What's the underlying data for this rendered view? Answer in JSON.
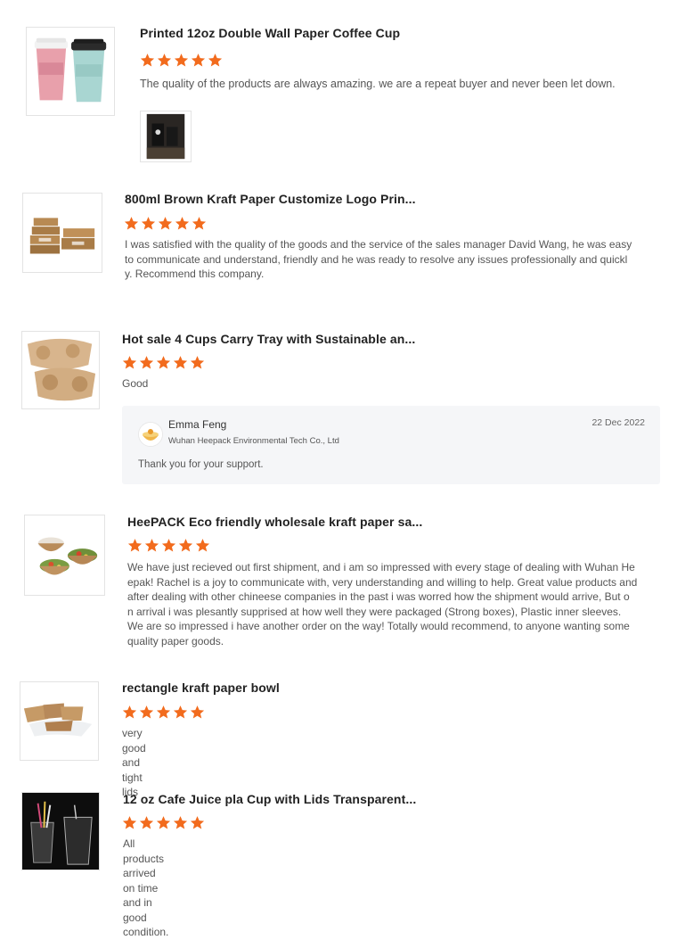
{
  "star_color": "#f26b1d",
  "reviews": [
    {
      "product_title": "Printed 12oz Double Wall Paper Coffee Cup",
      "rating": 5,
      "text": "The quality of the products are always amazing. we are a repeat buyer and never been let down.",
      "has_photo_attachment": true
    },
    {
      "product_title": "800ml Brown Kraft Paper Customize Logo Prin...",
      "rating": 5,
      "text_lines": [
        "I was satisfied with the quality of the goods and the service of the sales manager David Wang, he was easy",
        "to communicate and understand, friendly and he was ready to resolve any issues professionally and quickl",
        "y. Recommend this company."
      ]
    },
    {
      "product_title": "Hot sale 4 Cups Carry Tray with Sustainable an...",
      "rating": 5,
      "text": "Good",
      "reply": {
        "name": "Emma Feng",
        "company": "Wuhan Heepack Environmental Tech Co., Ltd",
        "date": "22 Dec 2022",
        "text": "Thank you for your support."
      }
    },
    {
      "product_title": "HeePACK Eco friendly wholesale kraft paper sa...",
      "rating": 5,
      "text_lines": [
        "We have just recieved out first shipment, and i am so impressed with every stage of dealing with Wuhan He",
        "epak! Rachel is a joy to communicate with, very understanding and willing to help. Great value products and",
        "after dealing with other chineese companies in the past i was worred how the shipment would arrive, But o",
        "n arrival i was plesantly supprised at how well they were packaged (Strong boxes), Plastic inner sleeves.",
        "We are so impressed i have another order on the way! Totally would recommend, to anyone wanting some",
        "quality paper goods."
      ]
    },
    {
      "product_title": "rectangle kraft paper bowl",
      "rating": 5,
      "text": "very good and tight lids"
    },
    {
      "product_title": "12 oz Cafe Juice pla Cup with Lids Transparent...",
      "rating": 5,
      "text": "All products arrived on time and in good condition."
    }
  ]
}
